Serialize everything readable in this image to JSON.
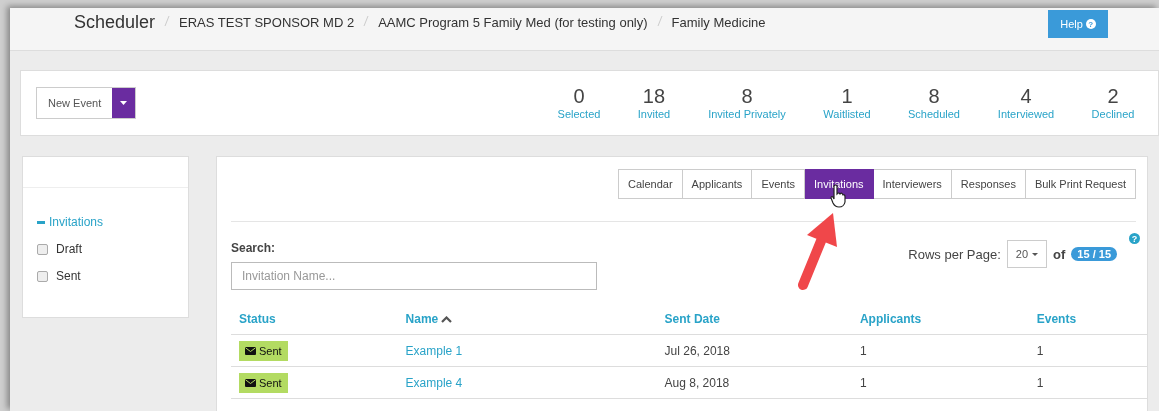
{
  "breadcrumb": [
    "Scheduler",
    "ERAS TEST SPONSOR MD 2",
    "AAMC Program 5 Family Med (for testing only)",
    "Family Medicine"
  ],
  "help_button": {
    "label": "Help",
    "icon": "?"
  },
  "new_event_button": "New Event",
  "stats": [
    {
      "value": "0",
      "label": "Selected"
    },
    {
      "value": "18",
      "label": "Invited"
    },
    {
      "value": "8",
      "label": "Invited Privately"
    },
    {
      "value": "1",
      "label": "Waitlisted"
    },
    {
      "value": "8",
      "label": "Scheduled"
    },
    {
      "value": "4",
      "label": "Interviewed"
    },
    {
      "value": "2",
      "label": "Declined"
    }
  ],
  "sidebar": {
    "section": "Invitations",
    "expanded": true,
    "filters": [
      {
        "label": "Draft",
        "checked": false
      },
      {
        "label": "Sent",
        "checked": false
      }
    ]
  },
  "tabs": [
    {
      "label": "Calendar",
      "selected": false
    },
    {
      "label": "Applicants",
      "selected": false
    },
    {
      "label": "Events",
      "selected": false
    },
    {
      "label": "Invitations",
      "selected": true
    },
    {
      "label": "Interviewers",
      "selected": false
    },
    {
      "label": "Responses",
      "selected": false
    },
    {
      "label": "Bulk Print Request",
      "selected": false
    }
  ],
  "search": {
    "label": "Search:",
    "placeholder": "Invitation Name..."
  },
  "pagination": {
    "label": "Rows per Page:",
    "page_size": "20",
    "of": "of",
    "count": "15 / 15",
    "help_icon": "?"
  },
  "table": {
    "columns": [
      {
        "label": "Status",
        "sorted": false
      },
      {
        "label": "Name",
        "sorted": true
      },
      {
        "label": "Sent Date",
        "sorted": false
      },
      {
        "label": "Applicants",
        "sorted": false
      },
      {
        "label": "Events",
        "sorted": false
      }
    ],
    "rows": [
      {
        "status": {
          "label": "Sent",
          "kind": "sent"
        },
        "name": "Example 1",
        "sent_date": "Jul 26, 2018",
        "applicants": "1",
        "events": "1"
      },
      {
        "status": {
          "label": "Sent",
          "kind": "sent"
        },
        "name": "Example 4",
        "sent_date": "Aug 8, 2018",
        "applicants": "1",
        "events": "1"
      }
    ]
  }
}
